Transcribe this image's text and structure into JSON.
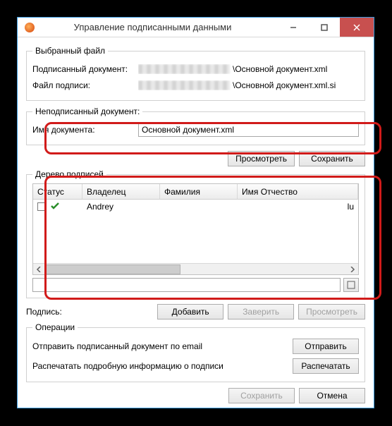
{
  "window": {
    "title": "Управление подписанными данными"
  },
  "selected_file": {
    "legend": "Выбранный файл",
    "signed_doc_label": "Подписанный документ:",
    "signed_doc_tail": "\\Основной документ.xml",
    "sig_file_label": "Файл подписи:",
    "sig_file_tail": "\\Основной документ.xml.si"
  },
  "unsigned_doc": {
    "legend": "Неподписанный документ:",
    "name_label": "Имя документа:",
    "name_value": "Основной документ.xml",
    "view_btn": "Просмотреть",
    "save_btn": "Сохранить"
  },
  "tree": {
    "legend": "Дерево подписей",
    "cols": {
      "status": "Статус",
      "owner": "Владелец",
      "lastname": "Фамилия",
      "name_patr": "Имя Отчество"
    },
    "rows": [
      {
        "owner": "Andrey",
        "trail": "lu"
      }
    ]
  },
  "signature": {
    "label": "Подпись:",
    "add_btn": "Добавить",
    "certify_btn": "Заверить",
    "view_btn": "Просмотреть"
  },
  "operations": {
    "legend": "Операции",
    "email_label": "Отправить подписанный документ по email",
    "send_btn": "Отправить",
    "print_label": "Распечатать подробную информацию о подписи",
    "print_btn": "Распечатать"
  },
  "footer": {
    "save_btn": "Сохранить",
    "cancel_btn": "Отмена"
  }
}
